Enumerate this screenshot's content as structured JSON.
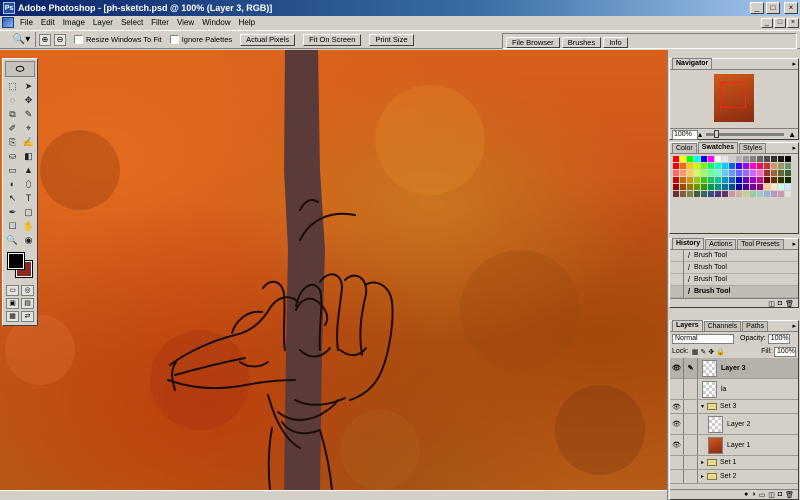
{
  "window": {
    "title": "Adobe Photoshop - [ph-sketch.psd @ 100% (Layer 3, RGB)]",
    "app_icon": "Ps",
    "controls": [
      "_",
      "□",
      "×"
    ]
  },
  "menu": {
    "items": [
      "File",
      "Edit",
      "Image",
      "Layer",
      "Select",
      "Filter",
      "View",
      "Window",
      "Help"
    ],
    "doc_controls": [
      "_",
      "□",
      "×"
    ]
  },
  "options": {
    "tool_icon": "zoom-tool-icon",
    "zoom_in": "⊕",
    "zoom_out": "⊖",
    "resize_windows": "Resize Windows To Fit",
    "ignore_palettes": "Ignore Palettes",
    "actual_pixels": "Actual Pixels",
    "fit_on_screen": "Fit On Screen",
    "print_size": "Print Size",
    "well_tabs": [
      "File Browser",
      "Brushes",
      "Info"
    ]
  },
  "toolbox": {
    "logo": "⬭",
    "tools": [
      "⬚",
      "➤",
      "◌",
      "✥",
      "⧉",
      "✎",
      "✐",
      "⌖",
      "⎘",
      "✍",
      "⛀",
      "◧",
      "▭",
      "▲",
      "◐",
      "⬯",
      "↖",
      "T",
      "✒",
      "▢",
      "☐",
      "✋",
      "🔍",
      "◉"
    ],
    "modes": [
      "▭",
      "◎",
      "▣",
      "▤",
      "▦",
      "⇄"
    ]
  },
  "navigator": {
    "tab": "Navigator",
    "zoom": "100%"
  },
  "color_panel": {
    "tabs": [
      "Color",
      "Swatches",
      "Styles"
    ],
    "active_tab": "Swatches",
    "swatches": [
      "#ff0000",
      "#ffff00",
      "#00ff00",
      "#00ffff",
      "#0000ff",
      "#ff00ff",
      "#ffffff",
      "#e6e6e6",
      "#cccccc",
      "#b3b3b3",
      "#999999",
      "#808080",
      "#666666",
      "#4d4d4d",
      "#333333",
      "#1a1a1a",
      "#000000",
      "#ff0000",
      "#ff6600",
      "#ffcc00",
      "#ccff00",
      "#66ff00",
      "#00ff66",
      "#00ffcc",
      "#00ccff",
      "#0066ff",
      "#3300ff",
      "#9900ff",
      "#ff00cc",
      "#ff0066",
      "#cc3333",
      "#cc9966",
      "#999966",
      "#669966",
      "#ff6666",
      "#ff9966",
      "#ffcc66",
      "#ccff66",
      "#99ff66",
      "#66ff99",
      "#66ffcc",
      "#66ccff",
      "#6699ff",
      "#6666ff",
      "#9966ff",
      "#cc66ff",
      "#ff66cc",
      "#993333",
      "#996633",
      "#666633",
      "#336633",
      "#cc0000",
      "#cc6600",
      "#cc9900",
      "#99cc00",
      "#33cc00",
      "#00cc66",
      "#00cc99",
      "#0099cc",
      "#0066cc",
      "#0000cc",
      "#6600cc",
      "#9900cc",
      "#cc0099",
      "#660000",
      "#663300",
      "#333300",
      "#003300",
      "#990000",
      "#994d00",
      "#997a00",
      "#669900",
      "#339900",
      "#00994d",
      "#009980",
      "#007a99",
      "#004d99",
      "#000099",
      "#4d0099",
      "#7a0099",
      "#990073",
      "#ffcc99",
      "#ffe6cc",
      "#ccffe6",
      "#cce6ff",
      "#663333",
      "#806040",
      "#808040",
      "#406040",
      "#336666",
      "#334d80",
      "#4d3380",
      "#663366",
      "#cc9999",
      "#ccb399",
      "#cccc99",
      "#99cc99",
      "#99cccc",
      "#99b3cc",
      "#b399cc",
      "#cc99b3",
      "#e0e0e0"
    ]
  },
  "history": {
    "tabs": [
      "History",
      "Actions",
      "Tool Presets"
    ],
    "active_tab": "History",
    "items": [
      "Brush Tool",
      "Brush Tool",
      "Brush Tool",
      "Brush Tool"
    ],
    "active_index": 3,
    "footer": [
      "◫",
      "◘",
      "🗑"
    ]
  },
  "layers": {
    "tabs": [
      "Layers",
      "Channels",
      "Paths"
    ],
    "active_tab": "Layers",
    "blend_mode": "Normal",
    "opacity_label": "Opacity:",
    "opacity": "100%",
    "lock_label": "Lock:",
    "fill_label": "Fill:",
    "fill": "100%",
    "rows": [
      {
        "name": "Layer 3",
        "kind": "layer",
        "eye": true,
        "brush": true,
        "thumb": "transparent",
        "active": true
      },
      {
        "name": "la",
        "kind": "layer",
        "eye": false,
        "brush": false,
        "thumb": "transparent",
        "active": false
      },
      {
        "name": "Set 3",
        "kind": "set",
        "eye": true,
        "brush": false,
        "expanded": true,
        "active": false
      },
      {
        "name": "Layer 2",
        "kind": "layer",
        "eye": true,
        "brush": false,
        "thumb": "transparent",
        "active": false,
        "indent": true
      },
      {
        "name": "Layer 1",
        "kind": "layer",
        "eye": true,
        "brush": false,
        "thumb": "fill",
        "active": false,
        "indent": true
      },
      {
        "name": "Set 1",
        "kind": "set",
        "eye": false,
        "brush": false,
        "expanded": false,
        "active": false
      },
      {
        "name": "Set 2",
        "kind": "set",
        "eye": false,
        "brush": false,
        "expanded": false,
        "active": false
      }
    ],
    "footer": [
      "●",
      "◑",
      "▭",
      "◫",
      "◘",
      "🗑"
    ]
  }
}
